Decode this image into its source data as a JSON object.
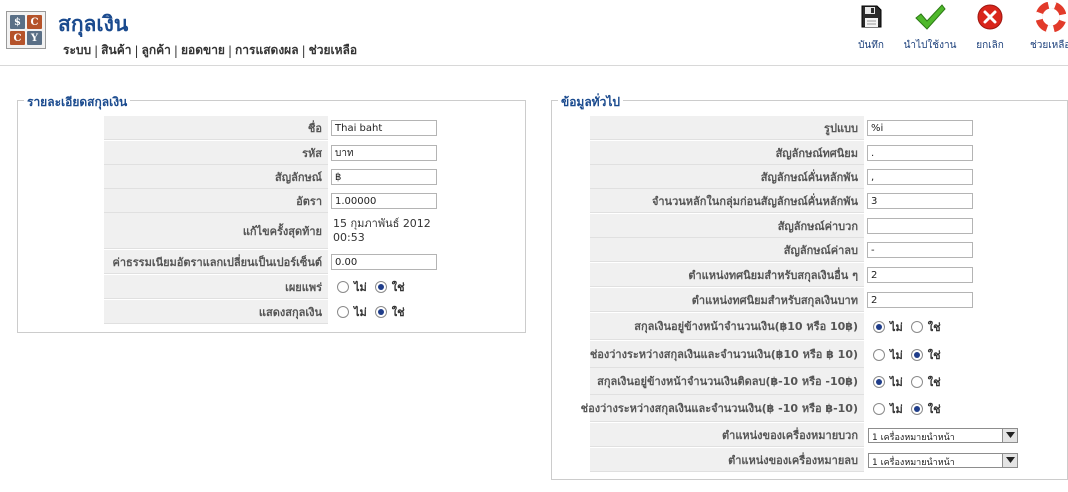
{
  "app": {
    "title": "สกุลเงิน",
    "logo_letters": [
      "$",
      "C",
      "C",
      "Y"
    ]
  },
  "menu": {
    "items": [
      "ระบบ",
      "สินค้า",
      "ลูกค้า",
      "ยอดขาย",
      "การแสดงผล",
      "ช่วยเหลือ"
    ],
    "separator": "|"
  },
  "toolbar": {
    "save_label": "บันทึก",
    "apply_label": "นำไปใช้งาน",
    "cancel_label": "ยกเลิก",
    "help_label": "ช่วยเหลือ",
    "icons": [
      "save-disk-icon",
      "checkmark-icon",
      "cancel-x-icon",
      "help-lifebuoy-icon"
    ]
  },
  "currency_details": {
    "legend": "รายละเอียดสกุลเงิน",
    "name_label": "ชื่อ",
    "name_value": "Thai baht",
    "code_label": "รหัส",
    "code_value": "บาท",
    "symbol_label": "สัญลักษณ์",
    "symbol_value": "฿",
    "rate_label": "อัตรา",
    "rate_value": "1.00000",
    "modified_label": "แก้ไขครั้งสุดท้าย",
    "modified_value_line1": "15 กุมภาพันธ์ 2012",
    "modified_value_line2": "00:53",
    "fee_label": "ค่าธรรมเนียมอัตราแลกเปลี่ยนเป็นเปอร์เซ็นต์",
    "fee_value": "0.00",
    "published_label": "เผยแพร่",
    "display_label": "แสดงสกุลเงิน",
    "no_label": "ไม่",
    "yes_label": "ใช่",
    "published_value": "yes",
    "display_value": "yes"
  },
  "general_info": {
    "legend": "ข้อมูลทั่วไป",
    "format_label": "รูปแบบ",
    "format_value": "%i",
    "decimal_symbol_label": "สัญลักษณ์ทศนิยม",
    "decimal_symbol_value": ".",
    "thousands_separator_label": "สัญลักษณ์คั่นหลักพัน",
    "thousands_separator_value": ",",
    "grouping_label": "จำนวนหลักในกลุ่มก่อนสัญลักษณ์คั่นหลักพัน",
    "grouping_value": "3",
    "positive_sign_label": "สัญลักษณ์ค่าบวก",
    "positive_sign_value": "",
    "negative_sign_label": "สัญลักษณ์ค่าลบ",
    "negative_sign_value": "-",
    "other_decimals_label": "ตำแหน่งทศนิยมสำหรับสกุลเงินอื่น ๆ",
    "other_decimals_value": "2",
    "baht_decimals_label": "ตำแหน่งทศนิยมสำหรับสกุลเงินบาท",
    "baht_decimals_value": "2",
    "symbol_before_amount_label": "สกุลเงินอยู่ข้างหน้าจำนวนเงิน(฿10 หรือ 10฿)",
    "space_between_label": "ช่องว่างระหว่างสกุลเงินและจำนวนเงิน(฿10 หรือ ฿ 10)",
    "symbol_before_negative_label": "สกุลเงินอยู่ข้างหน้าจำนวนเงินติดลบ(฿-10 หรือ -10฿)",
    "space_between_negative_label": "ช่องว่างระหว่างสกุลเงินและจำนวนเงิน(฿ -10 หรือ ฿-10)",
    "no_label": "ไม่",
    "yes_label": "ใช่",
    "symbol_before_amount_value": "no",
    "space_between_value": "yes",
    "symbol_before_negative_value": "no",
    "space_between_negative_value": "yes",
    "positive_sign_position_label": "ตำแหน่งของเครื่องหมายบวก",
    "positive_sign_position_value": "1 เครื่องหมายนำหน้า",
    "negative_sign_position_label": "ตำแหน่งของเครื่องหมายลบ",
    "negative_sign_position_value": "1 เครื่องหมายนำหน้า"
  }
}
